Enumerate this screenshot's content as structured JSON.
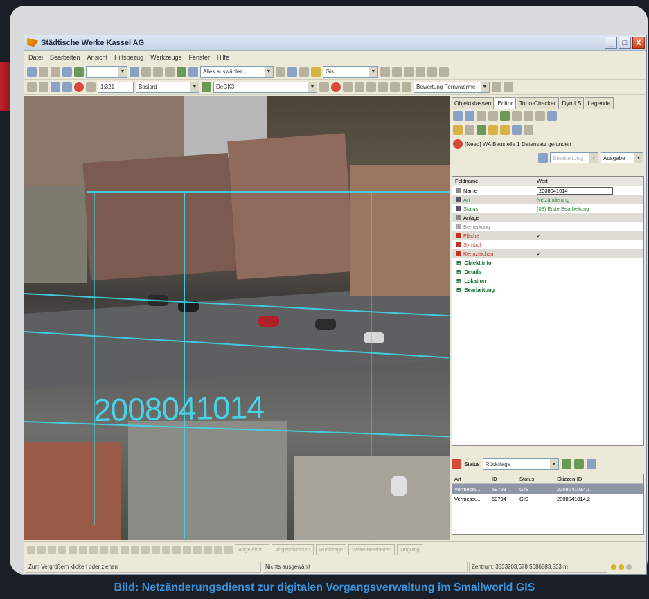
{
  "window": {
    "title": "Städtische Werke Kassel AG",
    "minimize": "_",
    "maximize": "□",
    "close": "X"
  },
  "menu": [
    "Datei",
    "Bearbeiten",
    "Ansicht",
    "Hilfsbezug",
    "Werkzeuge",
    "Fenster",
    "Hilfe"
  ],
  "toolbar1": {
    "select_all": "Alles auswählen",
    "layer": "Gis"
  },
  "toolbar2": {
    "scale": "1:321",
    "mode": "Basisrd",
    "crs": "DeGK3",
    "rating": "Bewertung Fernwaerme"
  },
  "panel": {
    "tabs": [
      "Objektklassen",
      "Editor",
      "ToLo-Checker",
      "Dyn.LS",
      "Legende"
    ],
    "active_tab": "Editor",
    "record_info": "[Need] WA Baustelle   1 Datensatz gefunden",
    "action_left": "Bearbeitung",
    "action_right": "Ausgabe",
    "attr_header": {
      "key": "Feldname",
      "value": "Wert"
    },
    "attributes": [
      {
        "key": "Name",
        "value": "2008041014",
        "color": "#333"
      },
      {
        "key": "Art",
        "value": "Netzänderung",
        "color": "#2a8a3a"
      },
      {
        "key": "Status",
        "value": "(03) Erste Bearbeitung",
        "color": "#2a8a3a"
      },
      {
        "key": "Anlage",
        "value": "",
        "color": "#333"
      },
      {
        "key": "Bemerkung",
        "value": "",
        "color": "#888"
      },
      {
        "key": "Fläche",
        "value": "✓",
        "color": "#c83020"
      },
      {
        "key": "Symbol",
        "value": "",
        "color": "#c83020"
      },
      {
        "key": "Kennzeichen",
        "value": "✓",
        "color": "#c83020"
      }
    ],
    "groups": [
      "Objekt Info",
      "Details",
      "Lokation",
      "Bearbeitung"
    ],
    "status_label": "Status",
    "status_value": "Rückfrage",
    "status_table": {
      "headers": [
        "Art",
        "ID",
        "Status",
        "Skizzen-ID"
      ],
      "rows": [
        [
          "Vermessu...",
          "59793",
          "GIS",
          "2008041014.1"
        ],
        [
          "Vermessu...",
          "59794",
          "GIS",
          "2008041014.2"
        ]
      ]
    }
  },
  "map": {
    "label": "2008041014"
  },
  "bottom_buttons": [
    "Abgelehnt...",
    "Abgeschlossen",
    "Rückfrage",
    "Weiterbearbeiten",
    "Ungültig"
  ],
  "statusbar": {
    "hint": "Zum Vergrößern klicken oder ziehen",
    "selection": "Nichts ausgewählt",
    "coords": "Zentrum: 3533203.678  5686883.533 m"
  },
  "caption": "Bild: Netzänderungsdienst zur digitalen Vorgangsverwaltung im Smallworld GIS",
  "colors": {
    "accent": "#3b92d8",
    "map_overlay": "#3fd6e8"
  }
}
